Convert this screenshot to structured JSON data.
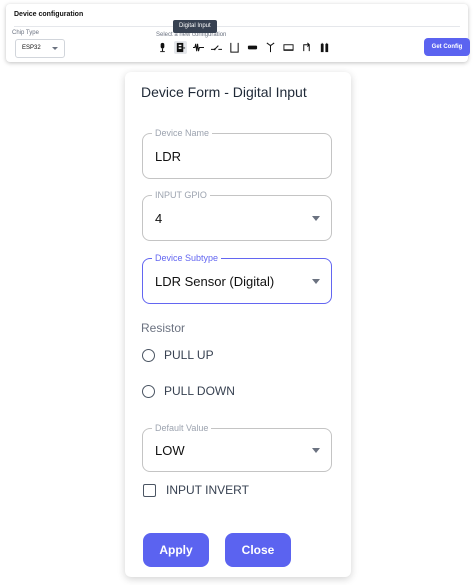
{
  "config": {
    "title": "Device configuration",
    "chip_type_label": "Chip Type",
    "chip_type_value": "ESP32",
    "select_config_label": "Select a new configuration",
    "tooltip": "Digital Input",
    "device_icons": [
      "microphone-icon",
      "digital-input-icon",
      "analog-signal-icon",
      "switch-icon",
      "relay-icon",
      "buzzer-icon",
      "antenna-icon",
      "display-icon",
      "swap-icon",
      "battery-icon"
    ],
    "get_config_label": "Get Config"
  },
  "form": {
    "title": "Device Form - Digital Input",
    "device_name_label": "Device Name",
    "device_name_value": "LDR",
    "input_gpio_label": "INPUT GPIO",
    "input_gpio_value": "4",
    "device_subtype_label": "Device Subtype",
    "device_subtype_value": "LDR Sensor (Digital)",
    "resistor_label": "Resistor",
    "pull_up_label": "PULL UP",
    "pull_down_label": "PULL DOWN",
    "default_value_label": "Default Value",
    "default_value_value": "LOW",
    "input_invert_label": "INPUT INVERT",
    "apply_label": "Apply",
    "close_label": "Close"
  },
  "colors": {
    "accent": "#5b63f0",
    "focus": "#6366f1"
  }
}
